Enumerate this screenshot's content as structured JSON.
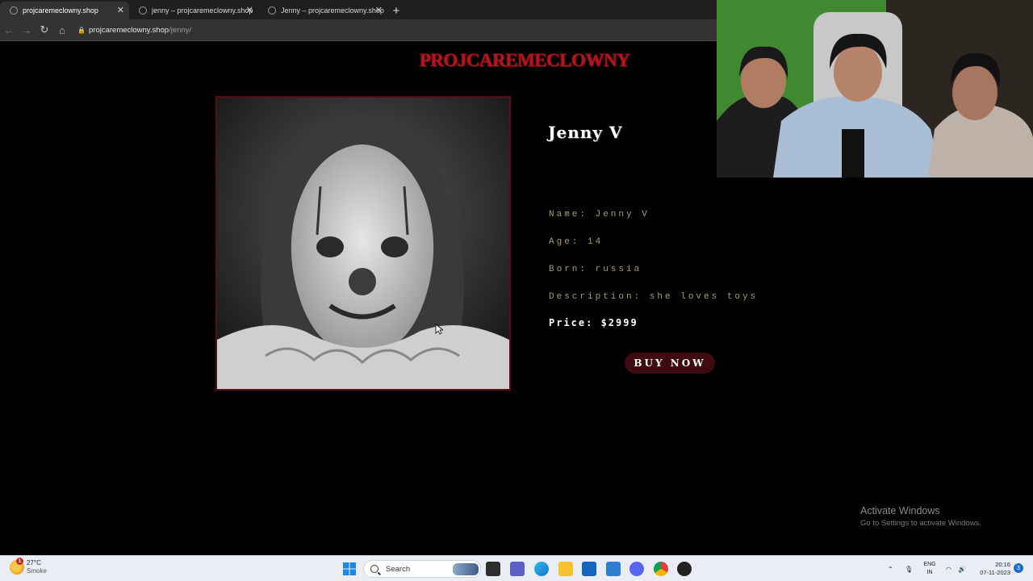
{
  "browser": {
    "tabs": [
      {
        "title": "projcaremeclowny.shop",
        "active": true
      },
      {
        "title": "jenny – projcaremeclowny.shop",
        "active": false
      },
      {
        "title": "Jenny – projcaremeclowny.shop",
        "active": false
      }
    ],
    "new_tab_icon": "plus-icon",
    "url_host": "projcaremeclowny.shop",
    "url_path": "/jenny/"
  },
  "page": {
    "site_logo": "PROJCAREMECLOWNY",
    "product_title": "Jenny V",
    "details": {
      "name": "Name: Jenny V",
      "age": "Age: 14",
      "born": "Born: russia",
      "description": "Description: she loves toys"
    },
    "price": "Price: $2999",
    "buy_label": "BUY NOW",
    "colors": {
      "logo": "#b3151e",
      "button": "#3d0b10",
      "info_text": "#a89e6c",
      "frame": "#5a0f15"
    }
  },
  "watermark": {
    "title": "Activate Windows",
    "subtitle": "Go to Settings to activate Windows."
  },
  "taskbar": {
    "weather_temp": "27°C",
    "weather_desc": "Smoke",
    "weather_badge": "1",
    "search_placeholder": "Search",
    "lang_line1": "ENG",
    "lang_line2": "IN",
    "time": "20:16",
    "date": "07-11-2023",
    "notifications": "3"
  }
}
